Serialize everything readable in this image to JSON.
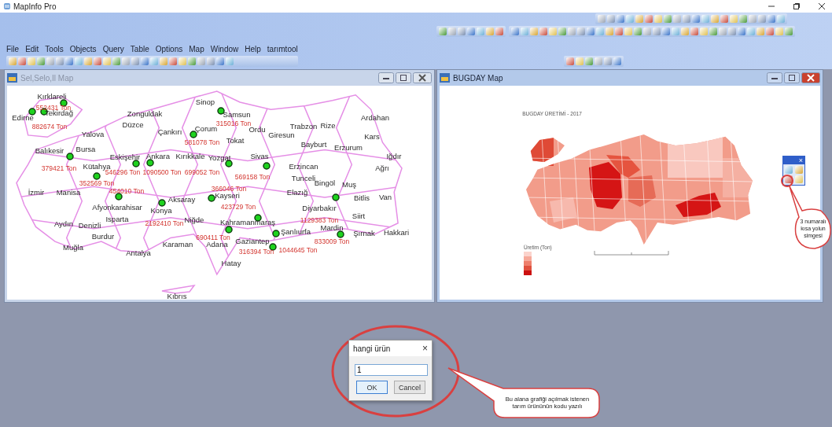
{
  "window": {
    "title": "MapInfo Pro"
  },
  "menu": [
    "File",
    "Edit",
    "Tools",
    "Objects",
    "Query",
    "Table",
    "Options",
    "Map",
    "Window",
    "Help",
    "tarımtool"
  ],
  "map_windows": [
    {
      "kind": "point_map",
      "title": "Sel,Selo,Il Map",
      "active": false,
      "provinces": [
        "Kırklareli",
        "Sinop",
        "Edirne",
        "Tekirdağ",
        "Zonguldak",
        "Samsun",
        "Ardahan",
        "Yalova",
        "Düzce",
        "Çankırı",
        "Çorum",
        "Tokat",
        "Ordu",
        "Giresun",
        "Trabzon",
        "Rize",
        "Kars",
        "Balıkesir",
        "Bursa",
        "Bayburt",
        "Erzurum",
        "Eskişehir",
        "Ankara",
        "Kırıkkale",
        "Yozgat",
        "Sivas",
        "Iğdır",
        "Kütahya",
        "Erzincan",
        "Ağrı",
        "Tunceli",
        "Bingöl",
        "Muş",
        "İzmir",
        "Manisa",
        "Aksaray",
        "Kayseri",
        "Elazığ",
        "Bitlis",
        "Van",
        "Afyonkarahisar",
        "Konya",
        "Diyarbakır",
        "Aydın",
        "Denizli",
        "Isparta",
        "Niğde",
        "Kahramanmaraş",
        "Siirt",
        "Burdur",
        "Şanlıurfa",
        "Mardin",
        "Şırnak",
        "Hakkari",
        "Muğla",
        "Antalya",
        "Karaman",
        "Adana",
        "Gaziantep",
        "Hatay",
        "Kıbrıs"
      ],
      "production_labels": [
        "552431 Ton",
        "882674 Ton",
        "315016 Ton",
        "581078 Ton",
        "379421 Ton",
        "546296 Ton",
        "1090500 Ton",
        "699052 Ton",
        "569158 Ton",
        "352569 Ton",
        "454010 Ton",
        "366046 Ton",
        "423729 Ton",
        "2192410 Ton",
        "1129383 Ton",
        "690411 Ton",
        "833009 Ton",
        "316394 Ton",
        "1044645 Ton"
      ]
    },
    {
      "kind": "choropleth",
      "title": "BUGDAY Map",
      "active": true,
      "map_title": "BUGDAY ÜRETİMİ - 2017",
      "legend_title": "Üretim (Ton)"
    }
  ],
  "shortcut_palette": {
    "close": "×"
  },
  "callouts": [
    {
      "text": "3 numaralı kısa yolun simgesi"
    },
    {
      "text": "Bu alana grafiği açılmak istenen tarım ürününün kodu yazılı"
    }
  ],
  "dialog": {
    "title": "hangi ürün",
    "close": "×",
    "input_value": "1",
    "buttons": [
      {
        "label": "OK",
        "default": true
      },
      {
        "label": "Cancel",
        "default": false
      }
    ]
  }
}
